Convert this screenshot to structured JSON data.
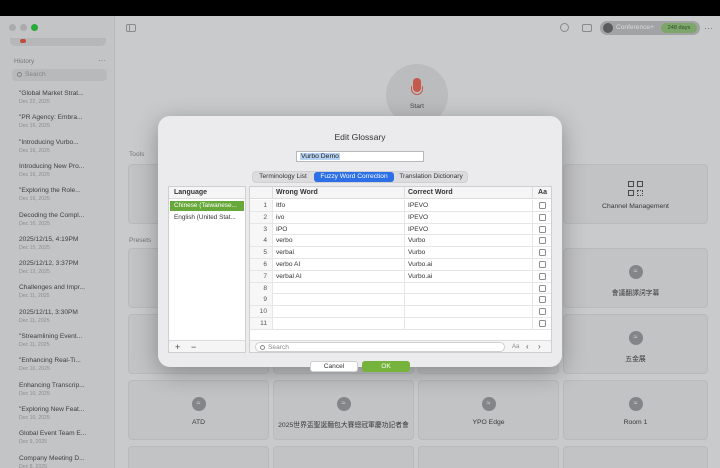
{
  "sidebar": {
    "history_label": "History",
    "more_glyph": "···",
    "search_placeholder": "Search",
    "items": [
      {
        "title": "\"Global Market Strat...",
        "date": "Dec 22, 2025"
      },
      {
        "title": "\"PR Agency: Embra...",
        "date": "Dec 16, 2025"
      },
      {
        "title": "\"Introducing Vurbo...",
        "date": "Dec 16, 2025"
      },
      {
        "title": "Introducing New Pro...",
        "date": "Dec 16, 2025"
      },
      {
        "title": "\"Exploring the Role...",
        "date": "Dec 16, 2025"
      },
      {
        "title": "Decoding the Compl...",
        "date": "Dec 16, 2025"
      },
      {
        "title": "2025/12/15, 4:19PM",
        "date": "Dec 15, 2025"
      },
      {
        "title": "2025/12/12, 3:37PM",
        "date": "Dec 12, 2025"
      },
      {
        "title": "Challenges and Impr...",
        "date": "Dec 11, 2025"
      },
      {
        "title": "2025/12/11, 3:30PM",
        "date": "Dec 11, 2025"
      },
      {
        "title": "\"Streamlining Event...",
        "date": "Dec 11, 2025"
      },
      {
        "title": "\"Enhancing Real-Ti...",
        "date": "Dec 10, 2025"
      },
      {
        "title": "Enhancing Transcrip...",
        "date": "Dec 10, 2025"
      },
      {
        "title": "\"Exploring New Feat...",
        "date": "Dec 10, 2025"
      },
      {
        "title": "Global Event Team E...",
        "date": "Dec 9, 2025"
      },
      {
        "title": "Company Meeting D...",
        "date": "Dec 8, 2025"
      }
    ]
  },
  "header": {
    "plan_label": "Conference+",
    "days_badge": "248 days",
    "more_glyph": "···"
  },
  "main": {
    "record_label": "Start",
    "tools_label": "Tools",
    "presets_label": "Presets",
    "tool_tiles": [
      {
        "label": "Channel Management"
      }
    ],
    "preset_tiles": [
      {
        "label": "會議翻譯詞字幕"
      },
      {
        "label": "五金展"
      },
      {
        "label": "ATD"
      },
      {
        "label": "2025世界盃聖誕麵包大賽總冠軍慶功記者會"
      },
      {
        "label": "YPO Edge"
      },
      {
        "label": "Room 1"
      }
    ]
  },
  "dialog": {
    "title": "Edit Glossary",
    "glossary_name": "Vurbo Demo",
    "tabs": [
      "Terminology List",
      "Fuzzy Word Correction",
      "Translation Dictionary"
    ],
    "active_tab": "Fuzzy Word Correction",
    "language_header": "Language",
    "languages": [
      "Chinese (Taiwanese...",
      "English (United Stat..."
    ],
    "add_glyph": "+",
    "remove_glyph": "−",
    "columns": {
      "wrong": "Wrong Word",
      "correct": "Correct Word",
      "case": "Aa"
    },
    "rows": [
      {
        "n": "1",
        "wrong": "Itfo",
        "correct": "IPEVO"
      },
      {
        "n": "2",
        "wrong": "ivo",
        "correct": "IPEVO"
      },
      {
        "n": "3",
        "wrong": "IPO",
        "correct": "IPEVO"
      },
      {
        "n": "4",
        "wrong": "verbo",
        "correct": "Vurbo"
      },
      {
        "n": "5",
        "wrong": "verbal",
        "correct": "Vurbo"
      },
      {
        "n": "6",
        "wrong": "verbo AI",
        "correct": "Vurbo.ai"
      },
      {
        "n": "7",
        "wrong": "verbal AI",
        "correct": "Vurbo.ai"
      },
      {
        "n": "8",
        "wrong": "",
        "correct": ""
      },
      {
        "n": "9",
        "wrong": "",
        "correct": ""
      },
      {
        "n": "10",
        "wrong": "",
        "correct": ""
      },
      {
        "n": "11",
        "wrong": "",
        "correct": ""
      }
    ],
    "search_placeholder": "Search",
    "case_toggle": "Aa",
    "prev_glyph": "‹",
    "next_glyph": "›",
    "cancel_label": "Cancel",
    "ok_label": "OK"
  },
  "colors": {
    "accent_blue": "#2c6fe6",
    "ok_green": "#76b33c",
    "selected_language": "#67a83a",
    "record_red": "#e7695a"
  }
}
